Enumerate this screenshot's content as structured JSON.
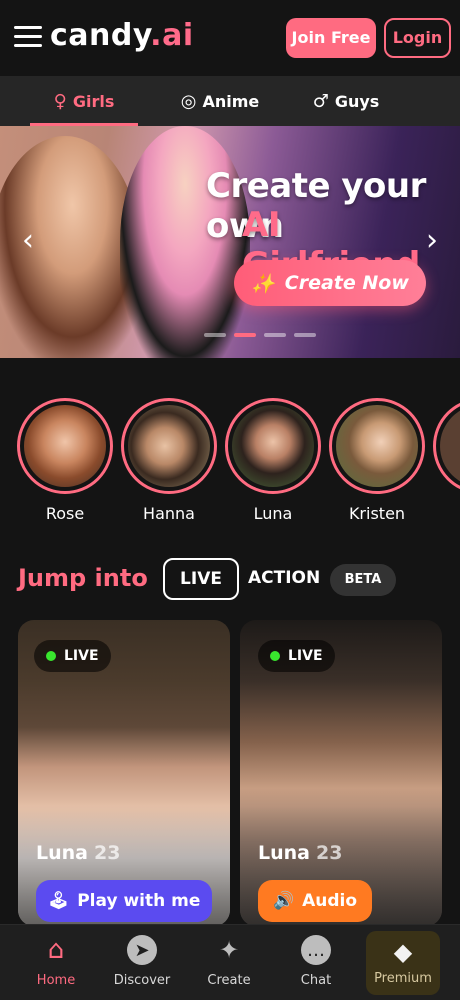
{
  "header": {
    "logo_main": "candy",
    "logo_dot": ".",
    "logo_ai": "ai",
    "join_label": "Join Free",
    "login_label": "Login"
  },
  "tabs": [
    {
      "label": "Girls",
      "icon": "female-icon",
      "glyph": "♀"
    },
    {
      "label": "Anime",
      "icon": "anime-spiral-icon",
      "glyph": "◎"
    },
    {
      "label": "Guys",
      "icon": "male-icon",
      "glyph": "♂"
    }
  ],
  "banner": {
    "title_line1": "Create your own",
    "title_line2": "AI Girlfriend",
    "cta_label": "Create Now",
    "cta_icon": "magic-wand-icon",
    "slides": 4,
    "active_slide": 2
  },
  "stories": [
    {
      "name": "Rose"
    },
    {
      "name": "Hanna"
    },
    {
      "name": "Luna"
    },
    {
      "name": "Kristen"
    }
  ],
  "jump": {
    "title": "Jump into",
    "live_label": "LIVE",
    "action_label": "ACTION",
    "beta_label": "BETA"
  },
  "cards": [
    {
      "badge": "LIVE",
      "name": "Luna",
      "age": "23",
      "button": "Play with me",
      "button_icon": "joystick-icon",
      "button_color": "#5b4bf0"
    },
    {
      "badge": "LIVE",
      "name": "Luna",
      "age": "23",
      "button": "Audio",
      "button_icon": "speaker-icon",
      "button_color": "#ff7a21"
    }
  ],
  "bottom_nav": {
    "home": "Home",
    "discover": "Discover",
    "create": "Create",
    "chat": "Chat",
    "premium": "Premium"
  },
  "colors": {
    "accent": "#ff6b81",
    "background": "#141414",
    "live_dot": "#39e62e"
  }
}
